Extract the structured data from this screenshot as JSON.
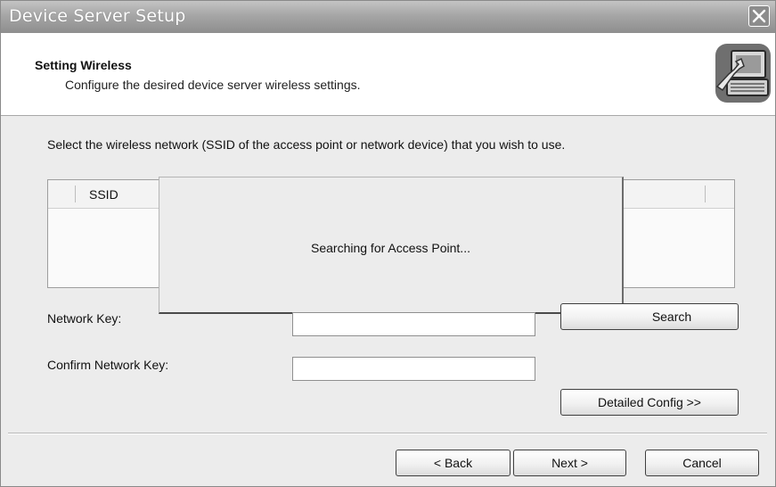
{
  "window": {
    "title": "Device Server Setup"
  },
  "header": {
    "title": "Setting Wireless",
    "subtitle": "Configure the desired device server wireless settings.",
    "icon": "device-setup-icon"
  },
  "main": {
    "instruction": "Select the wireless network (SSID of the access point or network device) that you wish to use.",
    "list": {
      "columns": [
        "SSID"
      ]
    },
    "popup": {
      "message": "Searching for Access Point..."
    },
    "network_key_label": "Network Key:",
    "confirm_key_label": "Confirm Network Key:",
    "network_key_value": "",
    "confirm_key_value": "",
    "search_label": "Search",
    "detailed_config_label": "Detailed Config >>"
  },
  "footer": {
    "back_label": "< Back",
    "next_label": "Next >",
    "cancel_label": "Cancel"
  }
}
